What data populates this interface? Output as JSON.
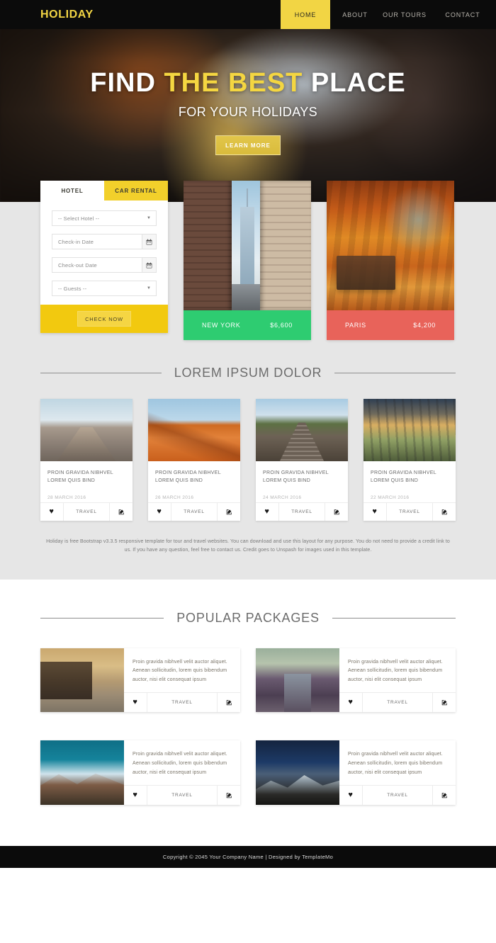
{
  "header": {
    "brand": "HOLIDAY",
    "nav": [
      {
        "label": "HOME",
        "active": true
      },
      {
        "label": "ABOUT",
        "active": false
      },
      {
        "label": "OUR TOURS",
        "active": false
      },
      {
        "label": "CONTACT",
        "active": false
      }
    ]
  },
  "hero": {
    "title_part1": "FIND ",
    "title_highlight": "THE BEST",
    "title_part2": " PLACE",
    "subtitle": "FOR YOUR HOLIDAYS",
    "cta": "LEARN MORE"
  },
  "booking": {
    "tabs": [
      {
        "label": "HOTEL",
        "active": true
      },
      {
        "label": "CAR RENTAL",
        "active": false
      }
    ],
    "hotel_select": "-- Select Hotel --",
    "checkin_placeholder": "Check-in Date",
    "checkout_placeholder": "Check-out Date",
    "guests_select": "-- Guests --",
    "submit": "CHECK NOW"
  },
  "cities": [
    {
      "name": "NEW YORK",
      "price": "$6,600",
      "color": "#2ecc71"
    },
    {
      "name": "PARIS",
      "price": "$4,200",
      "color": "#e8635a"
    }
  ],
  "blog_section": {
    "title": "LOREM IPSUM DOLOR",
    "cards": [
      {
        "title": "PROIN GRAVIDA NIBHVEL LOREM QUIS BIND",
        "date": "28 MARCH 2016",
        "tag": "TRAVEL"
      },
      {
        "title": "PROIN GRAVIDA NIBHVEL LOREM QUIS BIND",
        "date": "26 MARCH 2016",
        "tag": "TRAVEL"
      },
      {
        "title": "PROIN GRAVIDA NIBHVEL LOREM QUIS BIND",
        "date": "24 MARCH 2016",
        "tag": "TRAVEL"
      },
      {
        "title": "PROIN GRAVIDA NIBHVEL LOREM QUIS BIND",
        "date": "22 MARCH 2016",
        "tag": "TRAVEL"
      }
    ],
    "note": "Holiday is free Bootstrap v3.3.5 responsive template for tour and travel websites. You can download and use this layout for any purpose. You do not need to provide a credit link to us. If you have any question, feel free to contact us. Credit goes to Unspash for images used in this template."
  },
  "packages_section": {
    "title": "POPULAR PACKAGES",
    "cards": [
      {
        "text": "Proin gravida nibhvell velit auctor aliquet. Aenean sollicitudin, lorem quis bibendum auctor, nisi elit consequat ipsum",
        "tag": "TRAVEL"
      },
      {
        "text": "Proin gravida nibhvell velit auctor aliquet. Aenean sollicitudin, lorem quis bibendum auctor, nisi elit consequat ipsum",
        "tag": "TRAVEL"
      },
      {
        "text": "Proin gravida nibhvell velit auctor aliquet. Aenean sollicitudin, lorem quis bibendum auctor, nisi elit consequat ipsum",
        "tag": "TRAVEL"
      },
      {
        "text": "Proin gravida nibhvell velit auctor aliquet. Aenean sollicitudin, lorem quis bibendum auctor, nisi elit consequat ipsum",
        "tag": "TRAVEL"
      }
    ]
  },
  "footer": {
    "copyright": "Copyright © 2045 Your Company Name | Designed by TemplateMo"
  },
  "colors": {
    "brand_yellow": "#f2d544",
    "form_yellow": "#f2c90f",
    "dark": "#0b0b0b",
    "gray_bg": "#e6e6e6"
  }
}
